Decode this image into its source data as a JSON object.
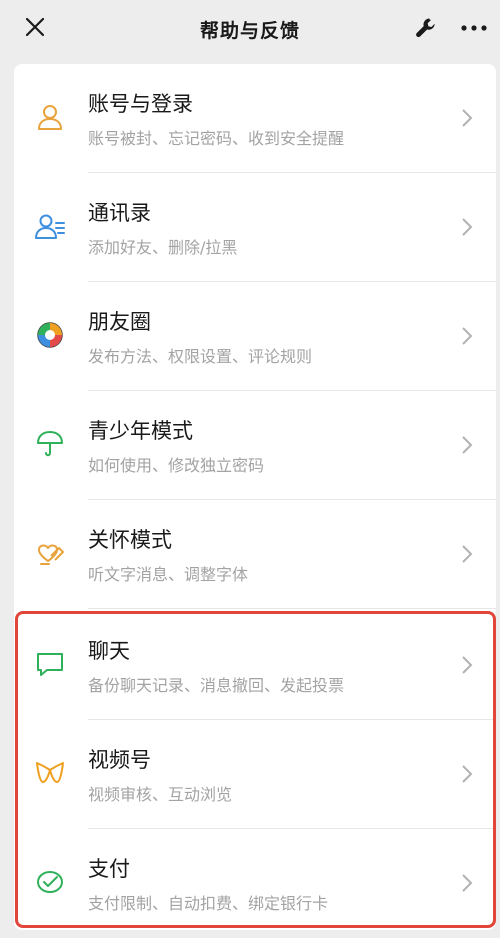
{
  "header": {
    "title": "帮助与反馈"
  },
  "items": [
    {
      "label": "账号与登录",
      "sub": "账号被封、忘记密码、收到安全提醒",
      "icon": "user-icon",
      "color": "#e8a33d"
    },
    {
      "label": "通讯录",
      "sub": "添加好友、删除/拉黑",
      "icon": "contacts-icon",
      "color": "#3d8fe0"
    },
    {
      "label": "朋友圈",
      "sub": "发布方法、权限设置、评论规则",
      "icon": "moments-icon",
      "color": "#f0a020"
    },
    {
      "label": "青少年模式",
      "sub": "如何使用、修改独立密码",
      "icon": "umbrella-icon",
      "color": "#2fb05a"
    },
    {
      "label": "关怀模式",
      "sub": "听文字消息、调整字体",
      "icon": "care-icon",
      "color": "#e8a33d"
    },
    {
      "label": "聊天",
      "sub": "备份聊天记录、消息撤回、发起投票",
      "icon": "chat-icon",
      "color": "#2fb05a"
    },
    {
      "label": "视频号",
      "sub": "视频审核、互动浏览",
      "icon": "channels-icon",
      "color": "#f0a020"
    },
    {
      "label": "支付",
      "sub": "支付限制、自动扣费、绑定银行卡",
      "icon": "pay-icon",
      "color": "#2fb05a"
    }
  ],
  "highlight_color": "#e2463a"
}
